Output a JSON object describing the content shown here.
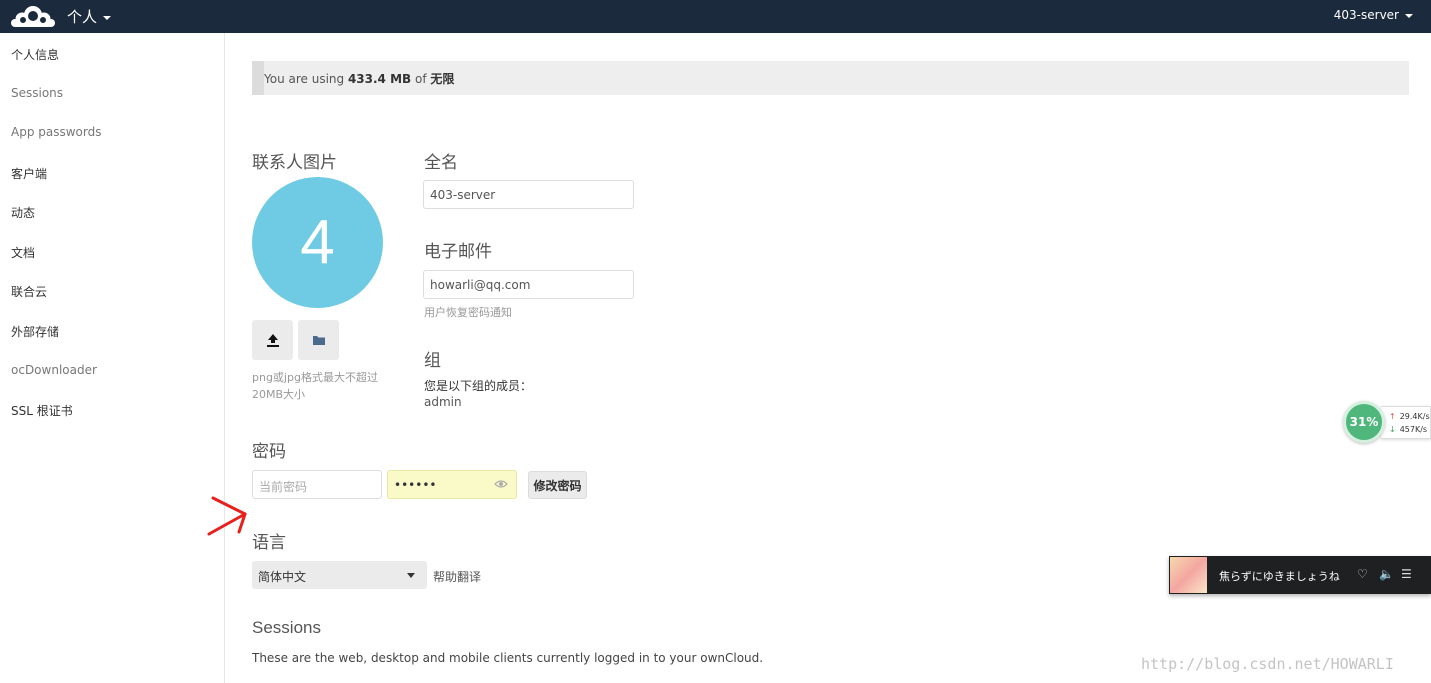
{
  "header": {
    "app_name": "个人",
    "user_name": "403-server",
    "header_color": "#1c2a3e"
  },
  "sidebar": {
    "items": [
      {
        "label": "个人信息"
      },
      {
        "label": "Sessions"
      },
      {
        "label": "App passwords"
      },
      {
        "label": "客户端"
      },
      {
        "label": "动态"
      },
      {
        "label": "文档"
      },
      {
        "label": "联合云"
      },
      {
        "label": "外部存储"
      },
      {
        "label": "ocDownloader"
      },
      {
        "label": "SSL 根证书"
      }
    ]
  },
  "quota": {
    "prefix": "You are using ",
    "used": "433.4 MB",
    "middle": " of ",
    "total": "无限"
  },
  "avatar": {
    "title": "联系人图片",
    "letter": "4",
    "color": "#6fcbe4",
    "upload_icon": "upload-icon",
    "folder_icon": "folder-icon",
    "hint": "png或jpg格式最大不超过20MB大小"
  },
  "fullname": {
    "title": "全名",
    "value": "403-server"
  },
  "email": {
    "title": "电子邮件",
    "value": "howarli@qq.com",
    "hint": "用户恢复密码通知"
  },
  "groups": {
    "title": "组",
    "description": "您是以下组的成员：",
    "members": "admin"
  },
  "password": {
    "title": "密码",
    "current_placeholder": "当前密码",
    "new_value": "••••••",
    "change_button": "修改密码"
  },
  "language": {
    "title": "语言",
    "selected": "简体中文",
    "help_link": "帮助翻译"
  },
  "sessions": {
    "title": "Sessions",
    "description": "These are the web, desktop and mobile clients currently logged in to your ownCloud."
  },
  "speed_widget": {
    "percent": "31%",
    "upload_speed": "29.4K/s",
    "download_speed": "457K/s"
  },
  "music_player": {
    "track": "焦らずにゆきましょうね",
    "icons": [
      "heart-icon",
      "volume-icon",
      "playlist-icon"
    ]
  },
  "watermark": "http://blog.csdn.net/HOWARLI"
}
